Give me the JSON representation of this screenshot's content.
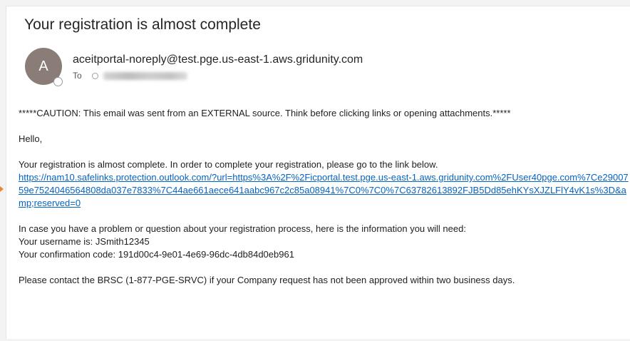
{
  "email": {
    "subject": "Your registration is almost complete",
    "avatar_initial": "A",
    "sender": "aceitportal-noreply@test.pge.us-east-1.aws.gridunity.com",
    "to_label": "To",
    "caution": "*****CAUTION: This email was sent from an EXTERNAL source. Think before clicking links or opening attachments.*****",
    "greeting": "Hello,",
    "intro": "Your registration is almost complete.  In order to complete your registration, please go to the link below.",
    "link": "https://nam10.safelinks.protection.outlook.com/?url=https%3A%2F%2Ficportal.test.pge.us-east-1.aws.gridunity.com%2FUser40pge.com%7Ce2900759e7524046564808da037e7833%7C44ae661aece641aabc967c2c85a08941%7C0%7C0%7C63782613892FJB5Dd85ehKYsXJZLFlY4vK1s%3D&amp;reserved=0",
    "info_intro": "In case you have a problem or question about your registration process, here is the information you will need:",
    "username_line": "Your username is: JSmith12345",
    "confirmation_line": "Your confirmation code: 191d00c4-9e01-4e69-96dc-4db84d0eb961",
    "contact_line": "Please contact the BRSC (1-877-PGE-SRVC) if your Company request has not been approved within two business days."
  },
  "colors": {
    "link": "#0563c1",
    "avatar": "#8a7d78",
    "side_arrow": "#e8883a"
  }
}
